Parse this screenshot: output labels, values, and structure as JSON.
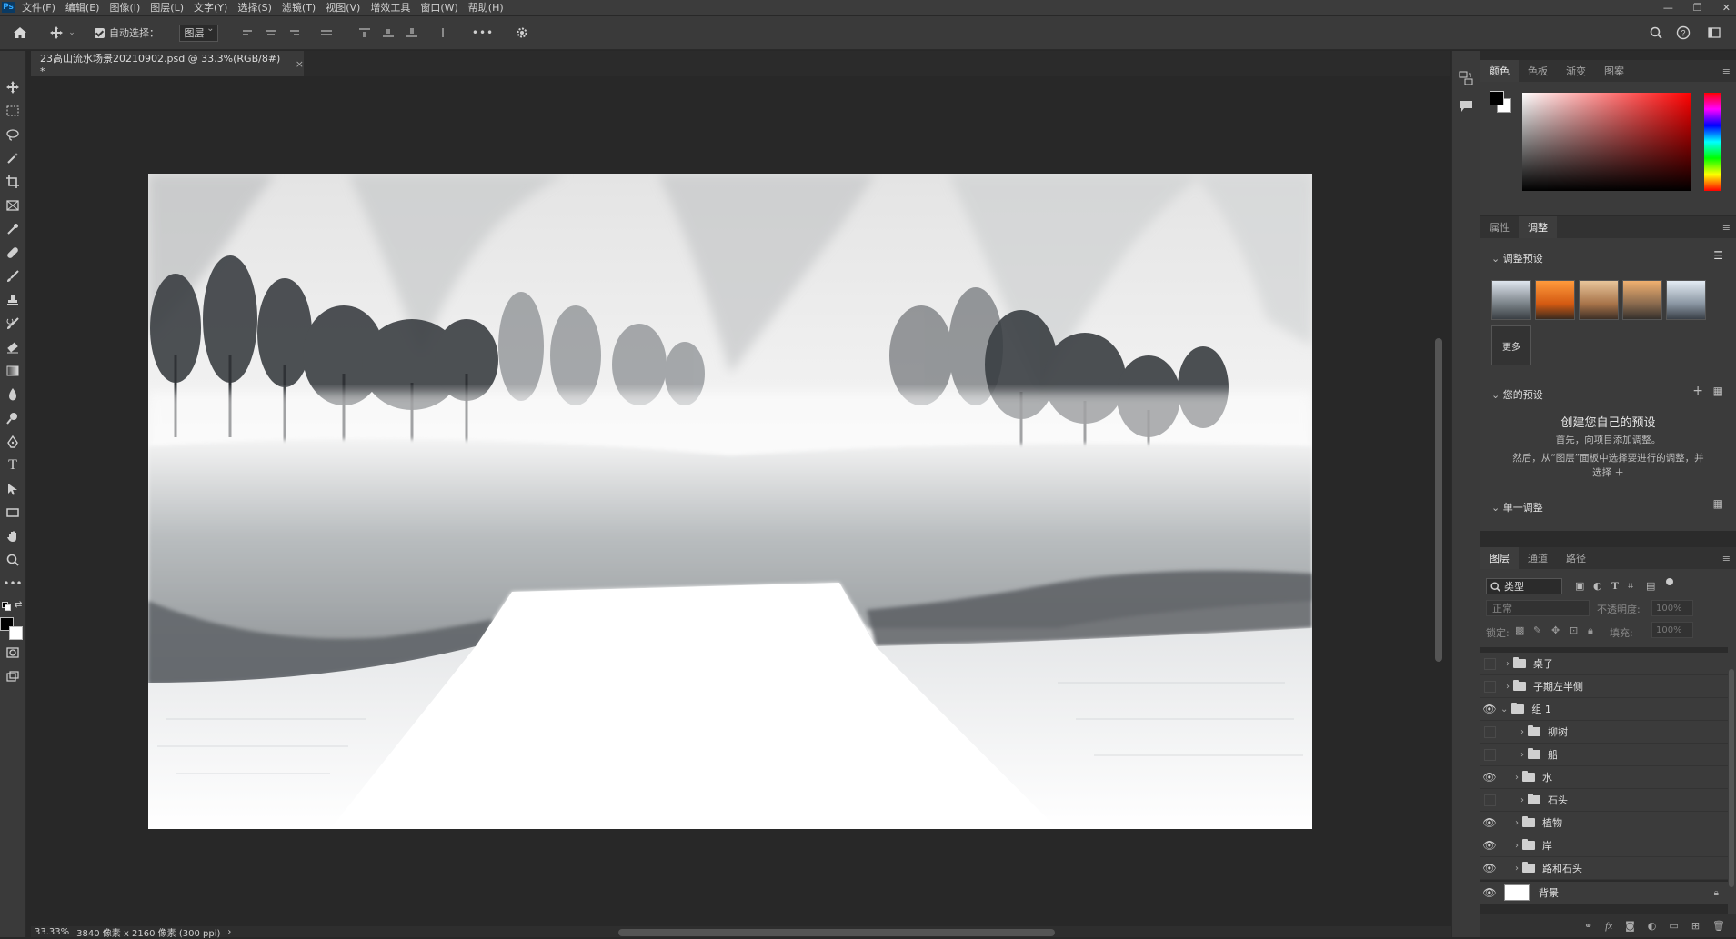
{
  "app": {
    "logo": "Ps"
  },
  "menu": [
    "文件(F)",
    "编辑(E)",
    "图像(I)",
    "图层(L)",
    "文字(Y)",
    "选择(S)",
    "滤镜(T)",
    "视图(V)",
    "增效工具",
    "窗口(W)",
    "帮助(H)"
  ],
  "window_controls": [
    "—",
    "❐",
    "✕"
  ],
  "options": {
    "auto_select_label": "自动选择：",
    "auto_select_target": "图层",
    "more": "•••"
  },
  "document": {
    "tab_title": "23高山流水场景20210902.psd @ 33.3%(RGB/8#) *",
    "close": "×"
  },
  "status": {
    "zoom": "33.33%",
    "info": "3840 像素 x 2160 像素 (300 ppi)",
    "arrow": "›"
  },
  "color_panel": {
    "tabs": [
      "颜色",
      "色板",
      "渐变",
      "图案"
    ],
    "foreground": "#000000",
    "background": "#ffffff",
    "hue": "#ff0000"
  },
  "adjust_panel": {
    "tabs": [
      "属性",
      "调整"
    ],
    "presets_heading": "调整预设",
    "more_label": "更多",
    "your_presets_heading": "您的预设",
    "create_title": "创建您自己的预设",
    "create_line1": "首先，向项目添加调整。",
    "create_line2": "然后，从“图层”面板中选择要进行的调整，并",
    "create_line3": "选择 ＋",
    "single_adjust_heading": "单一调整"
  },
  "layers_panel": {
    "tabs": [
      "图层",
      "通道",
      "路径"
    ],
    "filter_label": "类型",
    "blend_mode": "正常",
    "opacity_label": "不透明度:",
    "opacity_value": "100%",
    "lock_label": "锁定:",
    "fill_label": "填充:",
    "fill_value": "100%",
    "layers": [
      {
        "name": "桌子",
        "visible": false,
        "indent": 0,
        "kind": "folder",
        "expanded": false
      },
      {
        "name": "子期左半侧",
        "visible": false,
        "indent": 0,
        "kind": "folder",
        "expanded": false
      },
      {
        "name": "组 1",
        "visible": true,
        "indent": 0,
        "kind": "folder",
        "expanded": true
      },
      {
        "name": "柳树",
        "visible": false,
        "indent": 1,
        "kind": "folder",
        "expanded": false
      },
      {
        "name": "船",
        "visible": false,
        "indent": 1,
        "kind": "folder",
        "expanded": false
      },
      {
        "name": "水",
        "visible": true,
        "indent": 1,
        "kind": "folder",
        "expanded": false
      },
      {
        "name": "石头",
        "visible": false,
        "indent": 1,
        "kind": "folder",
        "expanded": false
      },
      {
        "name": "植物",
        "visible": true,
        "indent": 1,
        "kind": "folder",
        "expanded": false
      },
      {
        "name": "岸",
        "visible": true,
        "indent": 1,
        "kind": "folder",
        "expanded": false
      },
      {
        "name": "路和石头",
        "visible": true,
        "indent": 1,
        "kind": "folder",
        "expanded": false
      },
      {
        "name": "背景",
        "visible": true,
        "indent": 0,
        "kind": "image",
        "expanded": false
      }
    ],
    "footer_icons": [
      "link-icon",
      "fx-icon",
      "mask-icon",
      "adjustment-icon",
      "group-icon",
      "new-layer-icon",
      "trash-icon"
    ]
  }
}
